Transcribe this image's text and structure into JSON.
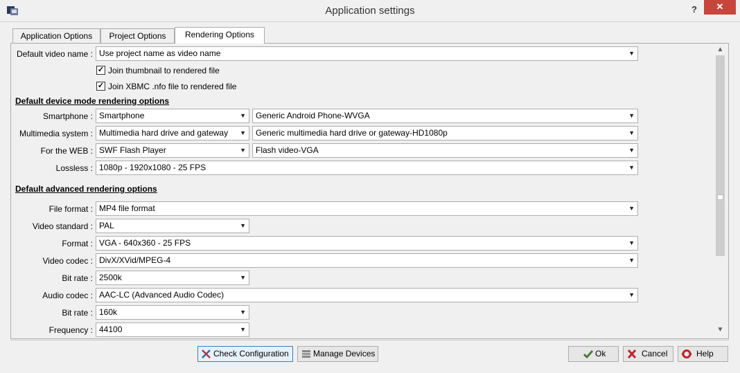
{
  "window": {
    "title": "Application settings",
    "help_glyph": "?",
    "close_glyph": "✕"
  },
  "tabs": [
    {
      "label": "Application Options",
      "active": false
    },
    {
      "label": "Project Options",
      "active": false
    },
    {
      "label": "Rendering Options",
      "active": true
    }
  ],
  "rendering": {
    "default_video_name": {
      "label": "Default video name :",
      "value": "Use project name as video name"
    },
    "join_thumbnail": {
      "label": "Join thumbnail to rendered file",
      "checked": true
    },
    "join_xbmc": {
      "label": "Join XBMC .nfo file to rendered file",
      "checked": true
    },
    "device_section": "Default device mode rendering options",
    "smartphone": {
      "label": "Smartphone :",
      "value": "Smartphone",
      "profile": "Generic Android Phone-WVGA"
    },
    "multimedia": {
      "label": "Multimedia system :",
      "value": "Multimedia hard drive and gateway",
      "profile": "Generic multimedia hard drive or gateway-HD1080p"
    },
    "web": {
      "label": "For the WEB :",
      "value": "SWF Flash Player",
      "profile": "Flash video-VGA"
    },
    "lossless": {
      "label": "Lossless :",
      "value": "1080p - 1920x1080 - 25 FPS"
    },
    "advanced_section": "Default advanced rendering options",
    "file_format": {
      "label": "File format :",
      "value": "MP4 file format"
    },
    "video_standard": {
      "label": "Video standard :",
      "value": "PAL"
    },
    "format": {
      "label": "Format :",
      "value": "VGA - 640x360 - 25 FPS"
    },
    "video_codec": {
      "label": "Video codec :",
      "value": "DivX/XVid/MPEG-4"
    },
    "video_bitrate": {
      "label": "Bit rate :",
      "value": "2500k"
    },
    "audio_codec": {
      "label": "Audio codec :",
      "value": "AAC-LC (Advanced Audio Codec)"
    },
    "audio_bitrate": {
      "label": "Bit rate :",
      "value": "160k"
    },
    "frequency": {
      "label": "Frequency :",
      "value": "44100"
    }
  },
  "buttons": {
    "check_configuration": "Check Configuration",
    "manage_devices": "Manage Devices",
    "ok": "Ok",
    "cancel": "Cancel",
    "help": "Help"
  },
  "icons": {
    "app": "app-icon",
    "check_configuration": "tools-icon",
    "manage_devices": "devices-icon",
    "ok": "checkmark-icon",
    "cancel": "x-icon",
    "help": "help-icon"
  },
  "colors": {
    "close_button": "#c7453b",
    "cancel_icon": "#c0232c",
    "ok_icon": "#4a7a3a"
  }
}
